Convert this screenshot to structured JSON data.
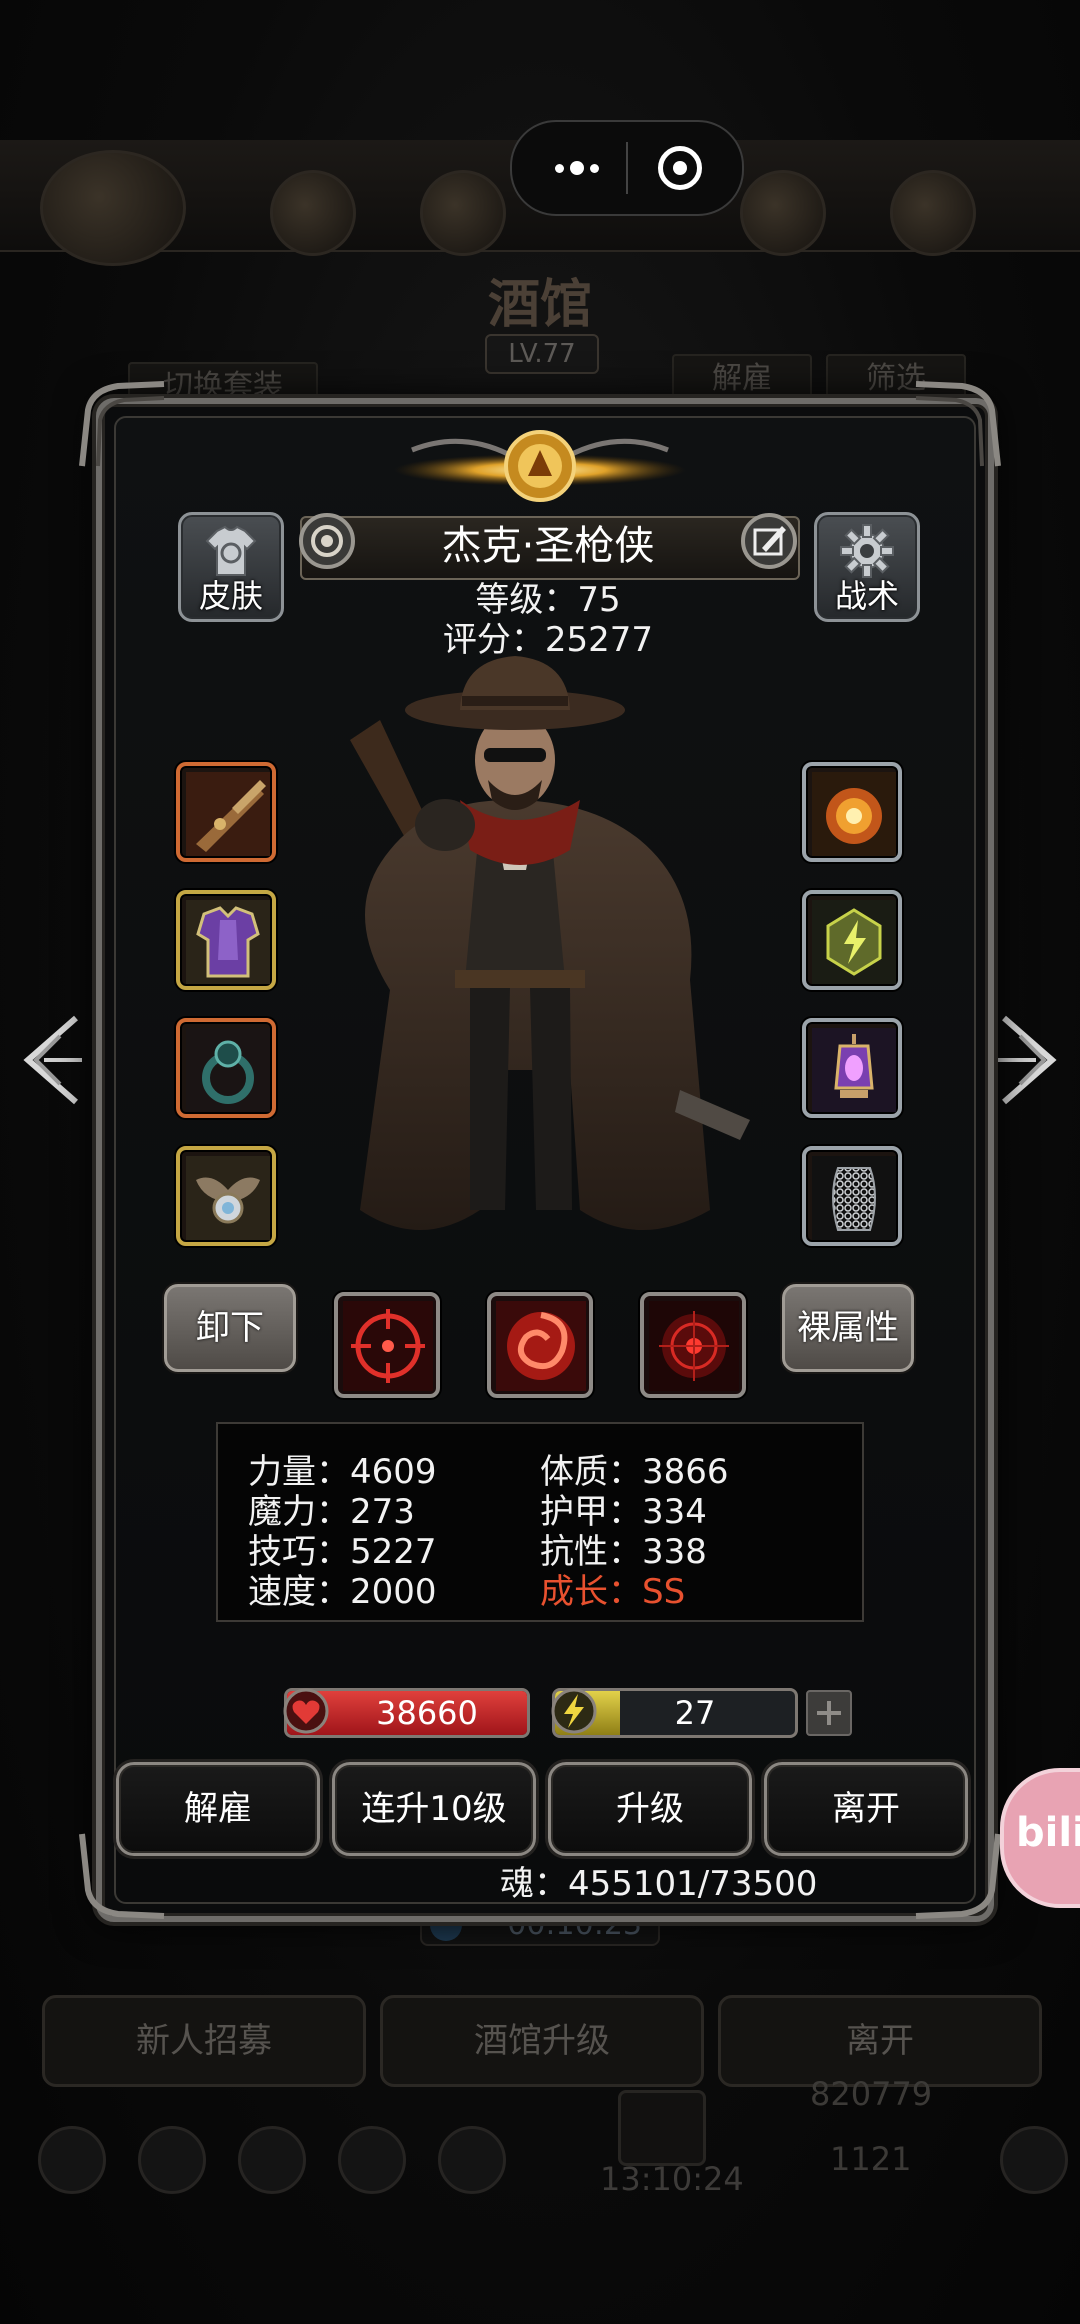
{
  "background": {
    "title": "酒馆",
    "level": "LV.77",
    "tab_switch": "切换套装",
    "tab_dismiss": "解雇",
    "tab_filter": "筛选",
    "timer": "00:10:23",
    "bottom_recruit": "新人招募",
    "bottom_upgrade": "酒馆升级",
    "bottom_leave": "离开",
    "gold": "820779",
    "gems": "1121",
    "clock": "13:10:24"
  },
  "hero": {
    "name": "杰克·圣枪侠",
    "level_text": "等级：75",
    "score_text": "评分：25277"
  },
  "buttons": {
    "skin": "皮肤",
    "tactics": "战术",
    "unequip": "卸下",
    "naked_attrs": "裸属性"
  },
  "equipment_left": [
    {
      "icon": "rifle-icon",
      "rarity": "orange"
    },
    {
      "icon": "armor-icon",
      "rarity": "gold"
    },
    {
      "icon": "ring-icon",
      "rarity": "orange"
    },
    {
      "icon": "amulet-icon",
      "rarity": "gold"
    }
  ],
  "equipment_right": [
    {
      "icon": "flame-orb-icon",
      "rarity": "silver"
    },
    {
      "icon": "lightning-gem-icon",
      "rarity": "silver"
    },
    {
      "icon": "lantern-icon",
      "rarity": "silver"
    },
    {
      "icon": "chainmail-icon",
      "rarity": "silver"
    }
  ],
  "skills": [
    "crosshair-skill-icon",
    "vortex-skill-icon",
    "target-skill-icon"
  ],
  "stats": {
    "strength": "力量：4609",
    "constitution": "体质：3866",
    "magic": "魔力：273",
    "armor": "护甲：334",
    "skill": "技巧：5227",
    "resistance": "抗性：338",
    "speed": "速度：2000",
    "growth": "成长：SS"
  },
  "hp": {
    "value": "38660",
    "fill": 1.0
  },
  "energy": {
    "value": "27",
    "fill": 0.27
  },
  "actions": {
    "dismiss": "解雇",
    "level_up_10": "连升10级",
    "level_up": "升级",
    "leave": "离开"
  },
  "soul": "魂：455101/73500",
  "badge": "bili",
  "colors": {
    "growth_red": "#e8512f",
    "hp_red": "#d4302f",
    "energy_yellow": "#d9c63e"
  }
}
